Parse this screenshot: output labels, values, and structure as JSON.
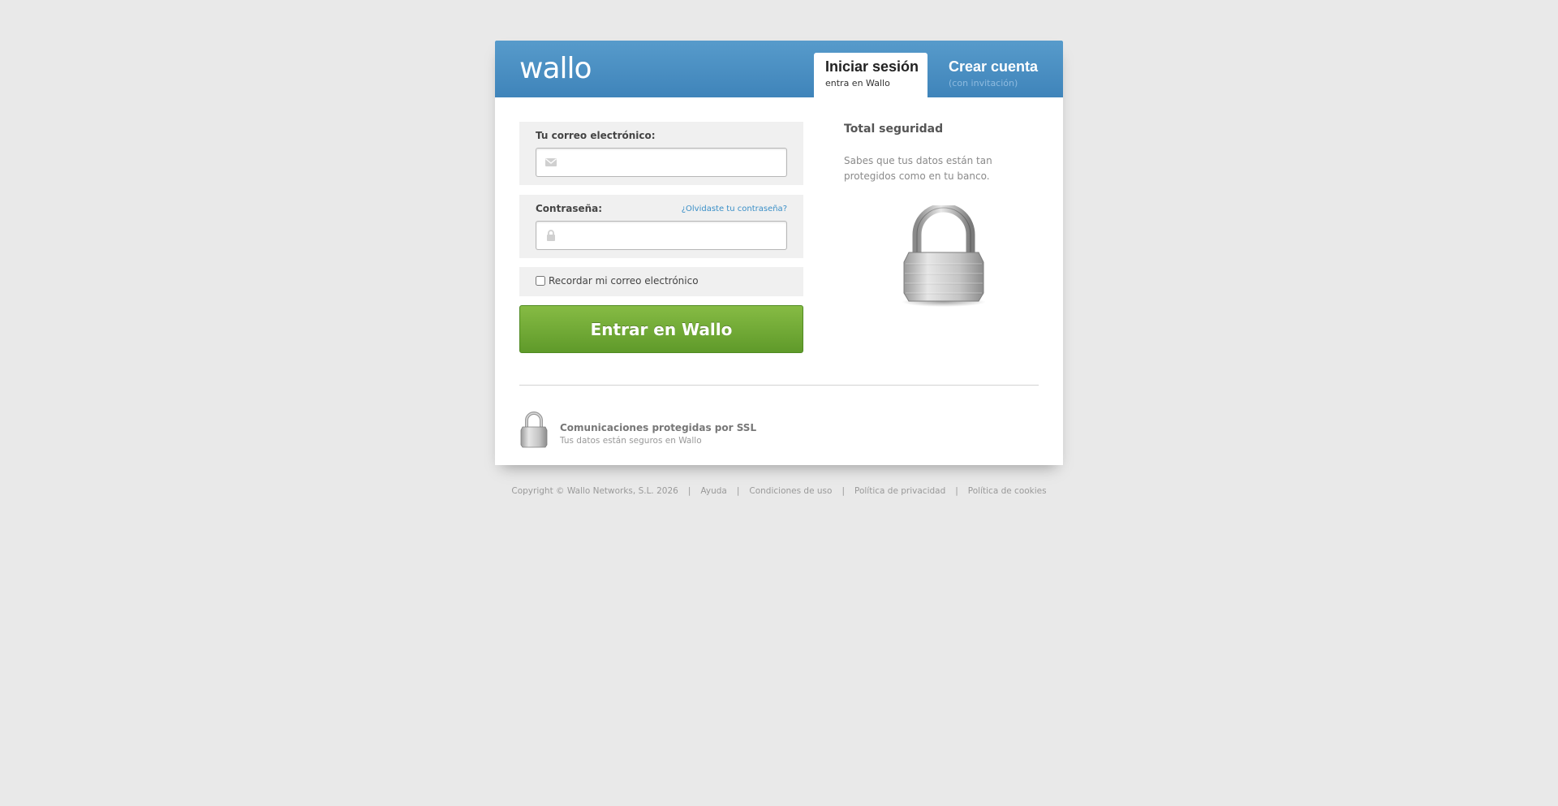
{
  "header": {
    "logo": "wallo",
    "tabs": [
      {
        "title": "Iniciar sesión",
        "subtitle": "entra en Wallo"
      },
      {
        "title": "Crear cuenta",
        "subtitle": "(con invitación)"
      }
    ]
  },
  "form": {
    "email_label": "Tu correo electrónico:",
    "email_value": "",
    "password_label": "Contraseña:",
    "password_value": "",
    "forgot_link": "¿Olvidaste tu contraseña?",
    "remember_label": "Recordar mi correo electrónico",
    "submit_label": "Entrar en Wallo"
  },
  "security": {
    "title": "Total seguridad",
    "text": "Sabes que tus datos están tan protegidos como en tu banco."
  },
  "ssl": {
    "title": "Comunicaciones protegidas por SSL",
    "subtitle": "Tus datos están seguros en Wallo"
  },
  "footer": {
    "copyright": "Copyright © Wallo Networks, S.L. 2026",
    "links": [
      "Ayuda",
      "Condiciones de uso",
      "Política de privacidad",
      "Política de cookies"
    ]
  },
  "colors": {
    "header_blue": "#4a8fc3",
    "button_green": "#74ab38",
    "link_blue": "#3a8fc7",
    "background": "#e9e9e9"
  },
  "icons": [
    "envelope-icon",
    "lock-icon",
    "padlock-icon"
  ]
}
